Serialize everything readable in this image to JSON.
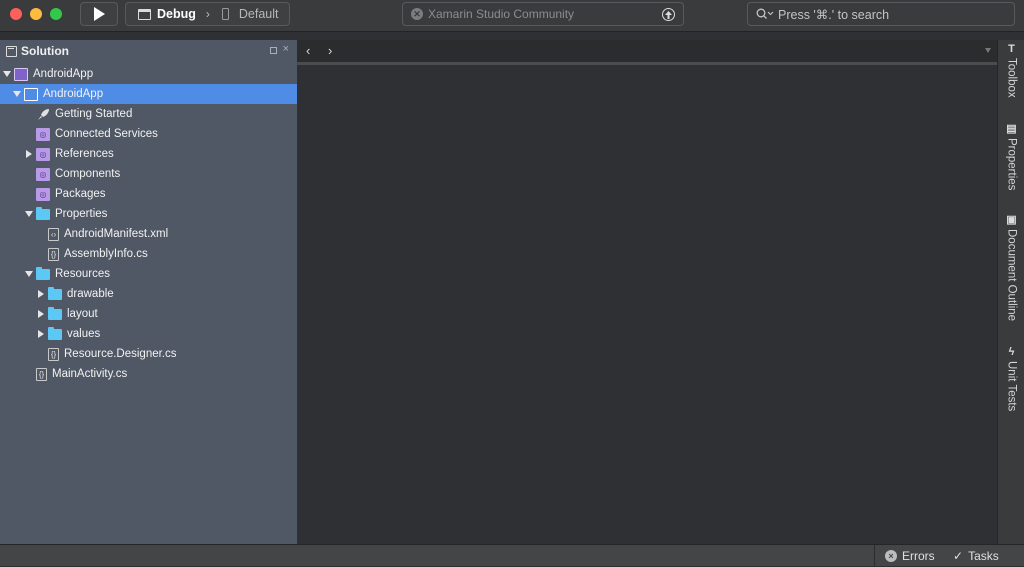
{
  "toolbar": {
    "config_label": "Debug",
    "config_separator": "›",
    "device_label": "Default",
    "status_text": "Xamarin Studio Community",
    "search_placeholder": "Press '⌘.' to search"
  },
  "solution": {
    "title": "Solution",
    "close_glyph": "×",
    "items": [
      {
        "label": "AndroidApp",
        "depth": 0,
        "expander": "down",
        "icon": "solution-icon"
      },
      {
        "label": "AndroidApp",
        "depth": 1,
        "expander": "down",
        "icon": "project-icon",
        "selected": true
      },
      {
        "label": "Getting Started",
        "depth": 2,
        "expander": "none",
        "icon": "rocket-icon"
      },
      {
        "label": "Connected Services",
        "depth": 2,
        "expander": "none",
        "icon": "services-icon"
      },
      {
        "label": "References",
        "depth": 2,
        "expander": "right",
        "icon": "references-icon"
      },
      {
        "label": "Components",
        "depth": 2,
        "expander": "none",
        "icon": "components-icon"
      },
      {
        "label": "Packages",
        "depth": 2,
        "expander": "none",
        "icon": "packages-icon"
      },
      {
        "label": "Properties",
        "depth": 2,
        "expander": "down",
        "icon": "folder-icon"
      },
      {
        "label": "AndroidManifest.xml",
        "depth": 3,
        "expander": "none",
        "icon": "xml-file-icon"
      },
      {
        "label": "AssemblyInfo.cs",
        "depth": 3,
        "expander": "none",
        "icon": "cs-file-icon"
      },
      {
        "label": "Resources",
        "depth": 2,
        "expander": "down",
        "icon": "folder-icon"
      },
      {
        "label": "drawable",
        "depth": 3,
        "expander": "right",
        "icon": "folder-icon"
      },
      {
        "label": "layout",
        "depth": 3,
        "expander": "right",
        "icon": "folder-icon"
      },
      {
        "label": "values",
        "depth": 3,
        "expander": "right",
        "icon": "folder-icon"
      },
      {
        "label": "Resource.Designer.cs",
        "depth": 3,
        "expander": "none",
        "icon": "cs-file-icon"
      },
      {
        "label": "MainActivity.cs",
        "depth": 2,
        "expander": "none",
        "icon": "cs-file-icon"
      }
    ]
  },
  "editor": {
    "back_glyph": "‹",
    "forward_glyph": "›"
  },
  "dock": {
    "items": [
      {
        "label": "Toolbox",
        "icon": "toolbox-icon",
        "glyph": "T"
      },
      {
        "label": "Properties",
        "icon": "properties-icon",
        "glyph": "▤"
      },
      {
        "label": "Document Outline",
        "icon": "outline-icon",
        "glyph": "▣"
      },
      {
        "label": "Unit Tests",
        "icon": "lightning-icon",
        "glyph": "ϟ"
      }
    ]
  },
  "statusbar": {
    "errors_label": "Errors",
    "tasks_label": "Tasks",
    "errors_glyph": "×",
    "tasks_glyph": "✓"
  },
  "colors": {
    "selection": "#4f8ce6",
    "folder": "#5bc8f5",
    "panel": "#505765",
    "editor": "#2f3033"
  }
}
